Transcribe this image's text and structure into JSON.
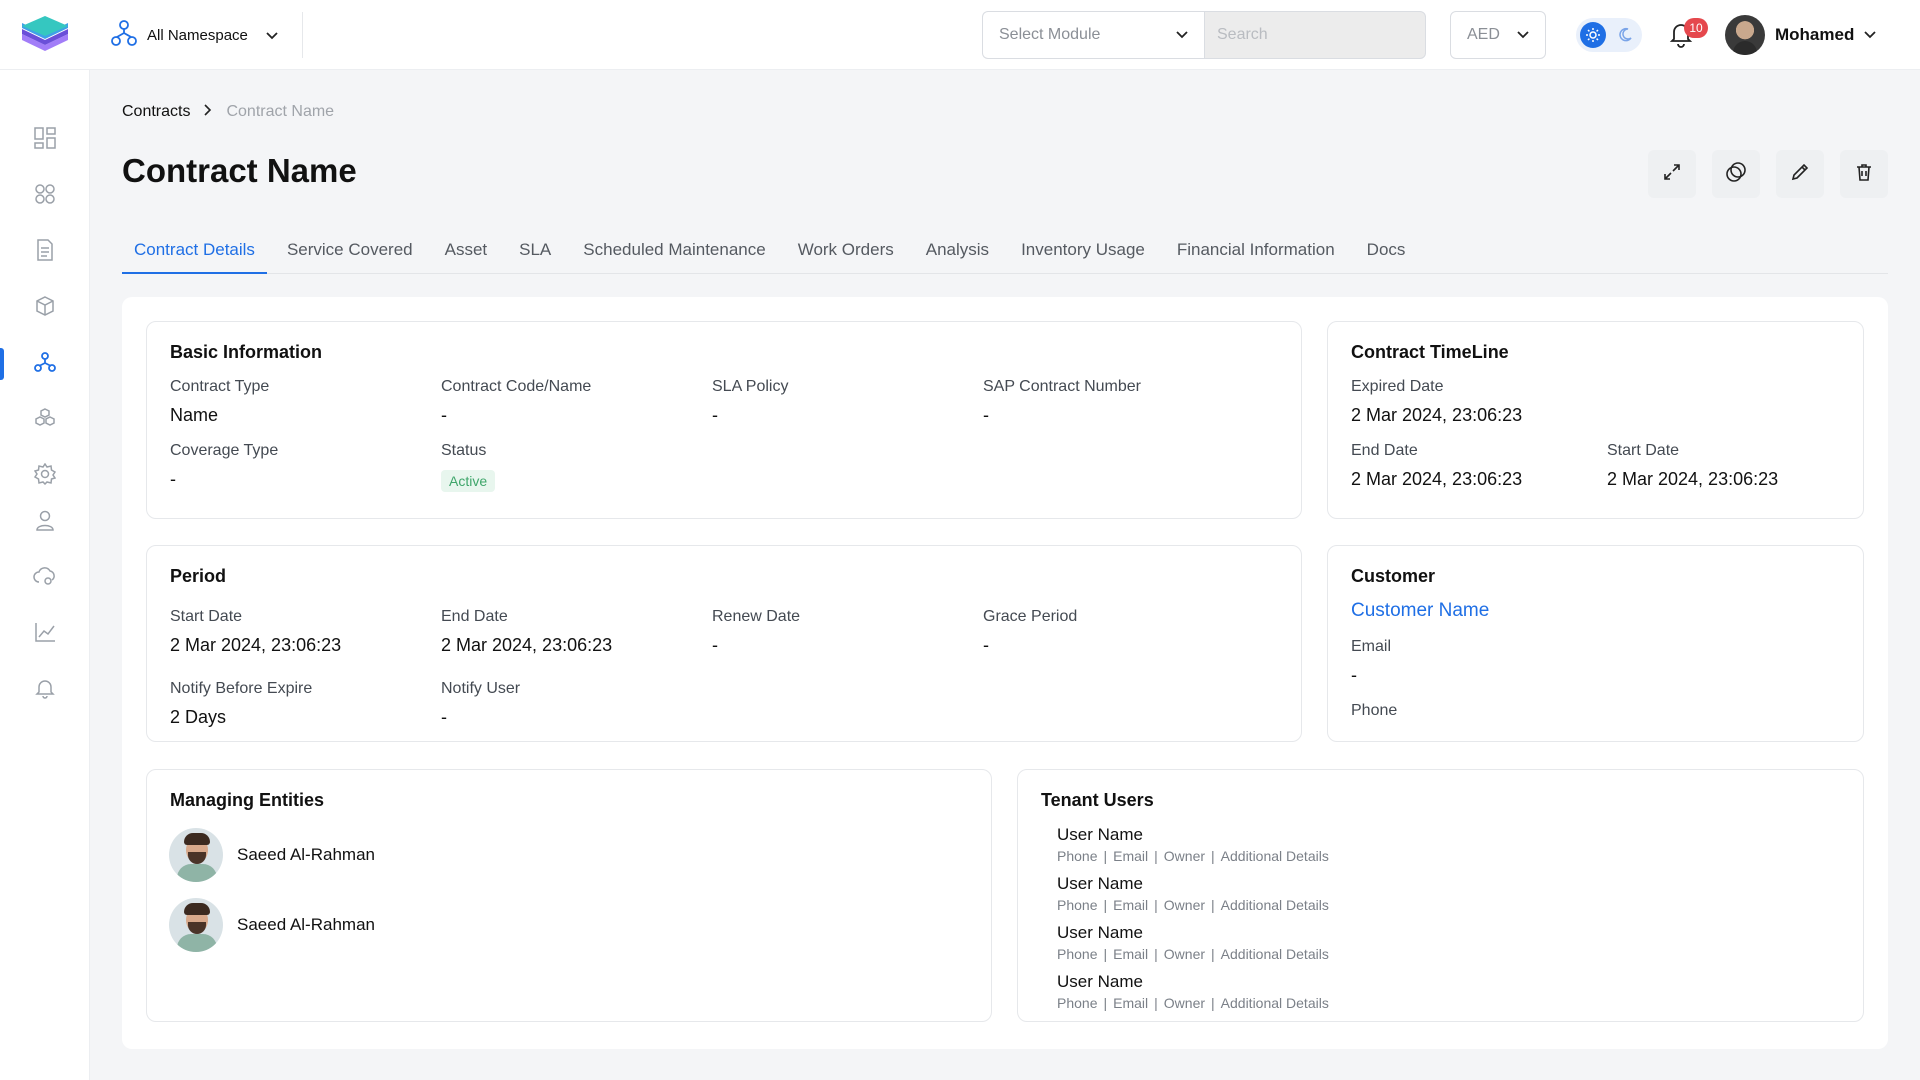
{
  "header": {
    "namespace_label": "All Namespace",
    "module_placeholder": "Select Module",
    "search_placeholder": "Search",
    "currency": "AED",
    "notification_count": "10",
    "user_name": "Mohamed",
    "accent_color": "#1f6fe5"
  },
  "sidebar": {
    "items": [
      {
        "icon": "dashboard-icon"
      },
      {
        "icon": "modules-icon"
      },
      {
        "icon": "document-icon"
      },
      {
        "icon": "box-icon"
      },
      {
        "icon": "network-icon",
        "active": true
      },
      {
        "icon": "stack-icon"
      },
      {
        "icon": "gear-icon"
      },
      {
        "icon": "user-icon"
      },
      {
        "icon": "cloud-settings-icon"
      },
      {
        "icon": "chart-icon"
      },
      {
        "icon": "bell-icon"
      }
    ]
  },
  "breadcrumb": {
    "parent": "Contracts",
    "current": "Contract Name"
  },
  "page": {
    "title": "Contract Name"
  },
  "tabs": [
    {
      "label": "Contract Details",
      "active": true
    },
    {
      "label": "Service Covered"
    },
    {
      "label": "Asset"
    },
    {
      "label": "SLA"
    },
    {
      "label": "Scheduled Maintenance"
    },
    {
      "label": "Work Orders"
    },
    {
      "label": "Analysis"
    },
    {
      "label": "Inventory Usage"
    },
    {
      "label": "Financial Information"
    },
    {
      "label": "Docs"
    }
  ],
  "basic_info": {
    "title": "Basic Information",
    "contract_type_label": "Contract Type",
    "contract_type": "Name",
    "contract_code_label": "Contract Code/Name",
    "contract_code": "-",
    "sla_policy_label": "SLA Policy",
    "sla_policy": "-",
    "sap_label": "SAP Contract Number",
    "sap": "-",
    "coverage_label": "Coverage Type",
    "coverage": "-",
    "status_label": "Status",
    "status": "Active"
  },
  "timeline": {
    "title": "Contract TimeLine",
    "expired_label": "Expired Date",
    "expired": "2 Mar 2024, 23:06:23",
    "end_label": "End Date",
    "end": "2 Mar 2024, 23:06:23",
    "start_label": "Start Date",
    "start": "2 Mar 2024, 23:06:23"
  },
  "period": {
    "title": "Period",
    "start_label": "Start Date",
    "start": "2 Mar 2024, 23:06:23",
    "end_label": "End Date",
    "end": "2 Mar 2024, 23:06:23",
    "renew_label": "Renew Date",
    "renew": "-",
    "grace_label": "Grace Period",
    "grace": "-",
    "notify_before_label": "Notify Before Expire",
    "notify_before": "2 Days",
    "notify_user_label": "Notify User",
    "notify_user": "-"
  },
  "customer": {
    "title": "Customer",
    "name": "Customer Name",
    "email_label": "Email",
    "email": "-",
    "phone_label": "Phone"
  },
  "managing": {
    "title": "Managing Entities",
    "entities": [
      {
        "name": "Saeed Al-Rahman"
      },
      {
        "name": "Saeed Al-Rahman"
      }
    ]
  },
  "tenants": {
    "title": "Tenant Users",
    "users": [
      {
        "name": "User Name",
        "phone": "Phone",
        "email": "Email",
        "owner": "Owner",
        "details": "Additional Details"
      },
      {
        "name": "User Name",
        "phone": "Phone",
        "email": "Email",
        "owner": "Owner",
        "details": "Additional Details"
      },
      {
        "name": "User Name",
        "phone": "Phone",
        "email": "Email",
        "owner": "Owner",
        "details": "Additional Details"
      },
      {
        "name": "User Name",
        "phone": "Phone",
        "email": "Email",
        "owner": "Owner",
        "details": "Additional Details"
      }
    ]
  }
}
